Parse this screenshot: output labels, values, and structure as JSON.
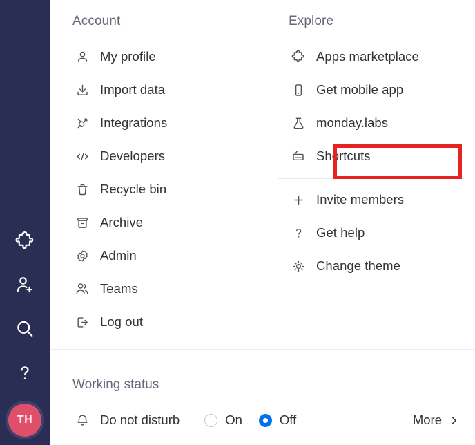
{
  "rail": {
    "buttons": [
      {
        "name": "apps-puzzle-icon",
        "icon": "puzzle"
      },
      {
        "name": "invite-member-icon",
        "icon": "person-plus"
      },
      {
        "name": "search-icon",
        "icon": "search"
      },
      {
        "name": "help-icon",
        "icon": "question"
      }
    ],
    "avatar": {
      "initials": "TH",
      "bg_color": "#e04f69",
      "ring_color": "#3e4169"
    },
    "background_color": "#2b2e54"
  },
  "account": {
    "title": "Account",
    "items": [
      {
        "label": "My profile",
        "icon": "person-icon"
      },
      {
        "label": "Import data",
        "icon": "download-icon"
      },
      {
        "label": "Integrations",
        "icon": "plug-icon"
      },
      {
        "label": "Developers",
        "icon": "code-icon"
      },
      {
        "label": "Recycle bin",
        "icon": "trash-icon"
      },
      {
        "label": "Archive",
        "icon": "archive-icon"
      },
      {
        "label": "Admin",
        "icon": "gear-icon"
      },
      {
        "label": "Teams",
        "icon": "people-icon"
      },
      {
        "label": "Log out",
        "icon": "logout-icon"
      }
    ]
  },
  "explore": {
    "title": "Explore",
    "items_top": [
      {
        "label": "Apps marketplace",
        "icon": "puzzle-icon"
      },
      {
        "label": "Get mobile app",
        "icon": "mobile-icon"
      },
      {
        "label": "monday.labs",
        "icon": "flask-icon"
      },
      {
        "label": "Shortcuts",
        "icon": "shortcuts-icon",
        "highlighted": true
      }
    ],
    "items_bottom": [
      {
        "label": "Invite members",
        "icon": "plus-icon"
      },
      {
        "label": "Get help",
        "icon": "question-icon"
      },
      {
        "label": "Change theme",
        "icon": "sun-icon"
      }
    ]
  },
  "working_status": {
    "title": "Working status",
    "dnd_label": "Do not disturb",
    "bell_icon": "bell-icon",
    "options": [
      {
        "label": "On",
        "selected": false
      },
      {
        "label": "Off",
        "selected": true
      }
    ],
    "more_label": "More",
    "more_icon": "chevron-right-icon",
    "accent_color": "#0073ea"
  },
  "highlight": {
    "color": "#e52421"
  }
}
